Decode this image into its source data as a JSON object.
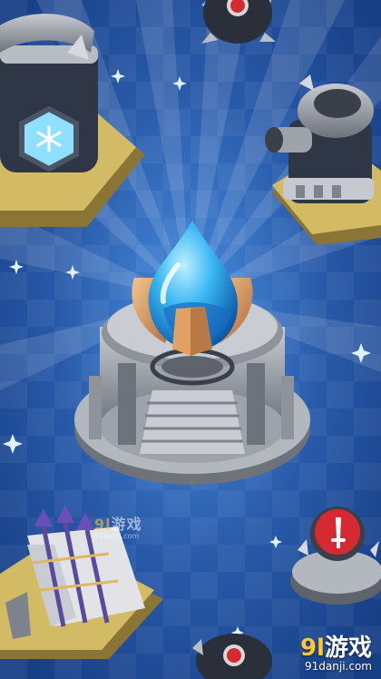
{
  "colors": {
    "bg_dark": "#173f86",
    "bg_light": "#2f6ac0",
    "gem": "#3ab8f2",
    "gold": "#e3a063",
    "stone": "#9ea3ab"
  },
  "watermark_center": {
    "brand_num": "9l",
    "brand_cn": "游戏",
    "domain": "91danji.com"
  },
  "watermark_corner": {
    "brand_num": "9l",
    "brand_cn": "游戏",
    "domain": "91danji.com"
  },
  "icons": [
    "sparkle-icon",
    "water-drop-gem-icon",
    "snowflake-icon",
    "sword-icon",
    "spiked-orb-icon"
  ]
}
